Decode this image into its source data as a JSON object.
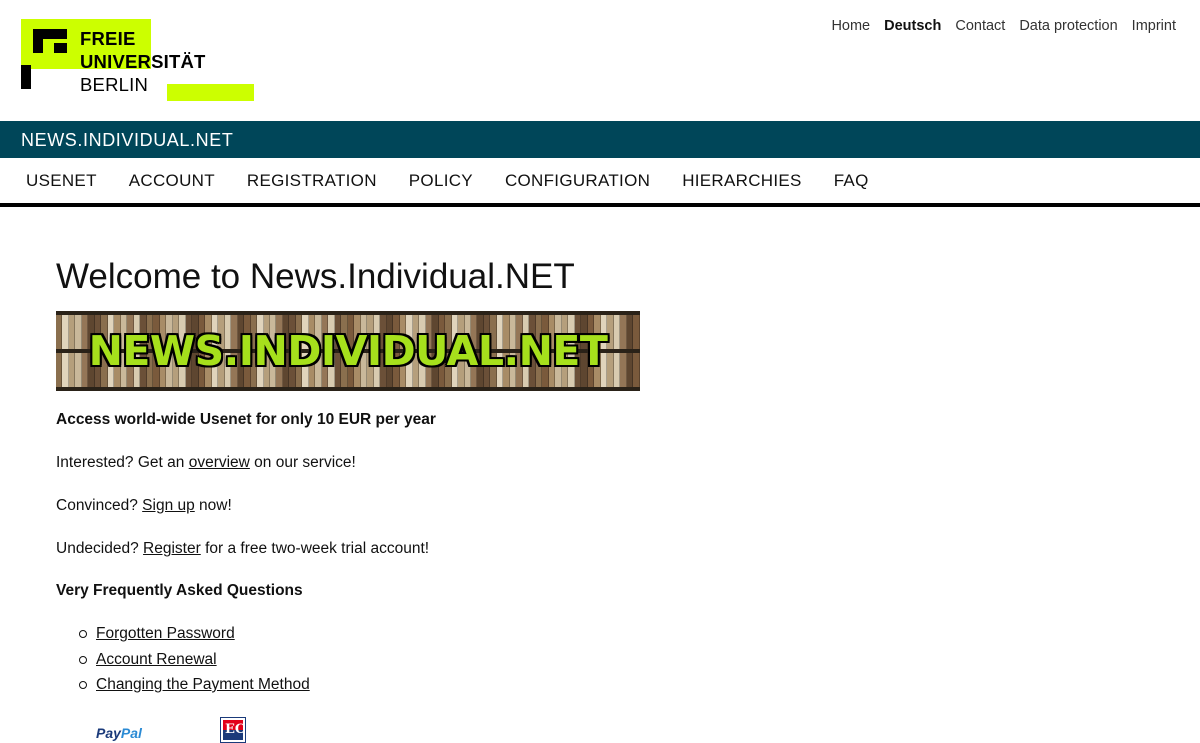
{
  "logo": {
    "line1": "FREIE",
    "line2": "UNIVERSITÄT",
    "line3": "BERLIN"
  },
  "service_nav": [
    {
      "label": "Home",
      "active": false
    },
    {
      "label": "Deutsch",
      "active": true
    },
    {
      "label": "Contact",
      "active": false
    },
    {
      "label": "Data protection",
      "active": false
    },
    {
      "label": "Imprint",
      "active": false
    }
  ],
  "site_title": "NEWS.INDIVIDUAL.NET",
  "main_nav": [
    "USENET",
    "ACCOUNT",
    "REGISTRATION",
    "POLICY",
    "CONFIGURATION",
    "HIERARCHIES",
    "FAQ"
  ],
  "page": {
    "title": "Welcome to News.Individual.NET",
    "banner_text": "NEWS.INDIVIDUAL.NET",
    "tagline": "Access world-wide Usenet for only 10 EUR per year",
    "line1": {
      "before": "Interested? Get an ",
      "link": "overview",
      "after": " on our service!"
    },
    "line2": {
      "before": "Convinced? ",
      "link": "Sign up",
      "after": " now!"
    },
    "line3": {
      "before": "Undecided? ",
      "link": "Register",
      "after": " for a free two-week trial account!"
    },
    "faq_heading": "Very Frequently Asked Questions",
    "faq_items": [
      "Forgotten Password",
      "Account Renewal",
      "Changing the Payment Method"
    ]
  },
  "payment": {
    "paypal_part1": "Pay",
    "paypal_part2": "Pal",
    "ec_label": "EC"
  },
  "colors": {
    "brand_green": "#ccff00",
    "site_bar": "#004659",
    "banner_text": "#a6e01c"
  }
}
